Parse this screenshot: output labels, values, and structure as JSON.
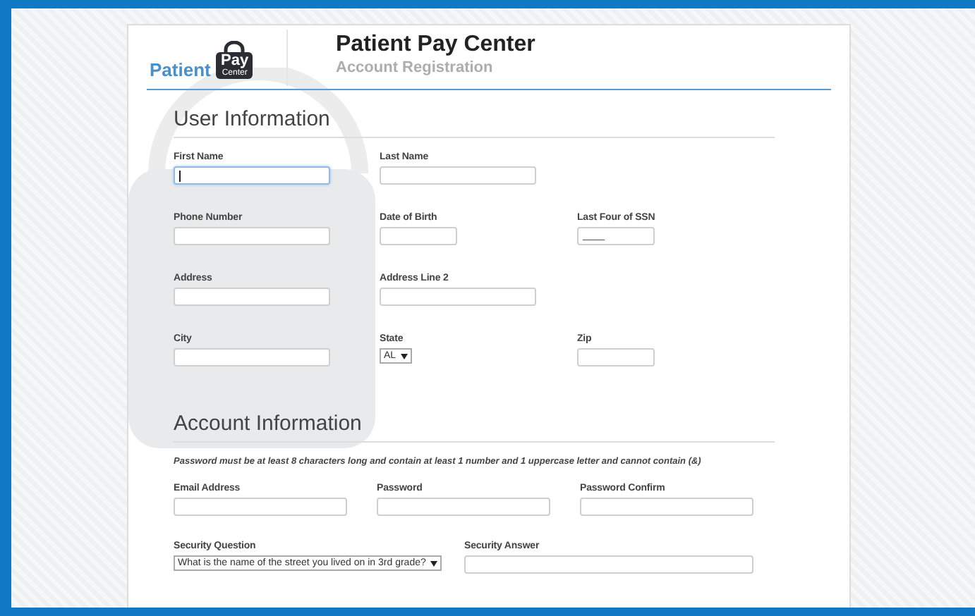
{
  "header": {
    "logo_word": "Patient",
    "logo_badge_top": "Pay",
    "logo_badge_bottom": "Center",
    "title": "Patient Pay Center",
    "subtitle": "Account Registration"
  },
  "sections": [
    {
      "title": "User Information",
      "rows": [
        [
          {
            "label": "First Name",
            "kind": "text",
            "focused": true
          },
          {
            "label": "Last Name",
            "kind": "text",
            "focused": false
          }
        ],
        [
          {
            "label": "Phone Number",
            "kind": "text",
            "focused": false
          },
          {
            "label": "Date of Birth",
            "kind": "text",
            "focused": false
          },
          {
            "label": "Last Four of SSN",
            "kind": "text",
            "focused": false,
            "value": "____"
          }
        ],
        [
          {
            "label": "Address",
            "kind": "text",
            "focused": false
          },
          {
            "label": "Address Line 2",
            "kind": "text",
            "focused": false
          }
        ],
        [
          {
            "label": "City",
            "kind": "text",
            "focused": false
          },
          {
            "label": "State",
            "kind": "select",
            "value": "AL"
          },
          {
            "label": "Zip",
            "kind": "text",
            "focused": false
          }
        ]
      ]
    },
    {
      "title": "Account Information",
      "note": "Password must be at least 8 characters long and contain at least 1 number and 1 uppercase letter and cannot contain (&)",
      "rows": [
        [
          {
            "label": "Email Address",
            "kind": "text",
            "focused": false
          },
          {
            "label": "Password",
            "kind": "text",
            "focused": false
          },
          {
            "label": "Password Confirm",
            "kind": "text",
            "focused": false
          }
        ]
      ],
      "security": [
        {
          "label": "Security Question",
          "kind": "select",
          "value": "What is the name of the street you lived on in 3rd grade?"
        },
        {
          "label": "Security Answer",
          "kind": "text",
          "focused": false
        }
      ]
    }
  ]
}
